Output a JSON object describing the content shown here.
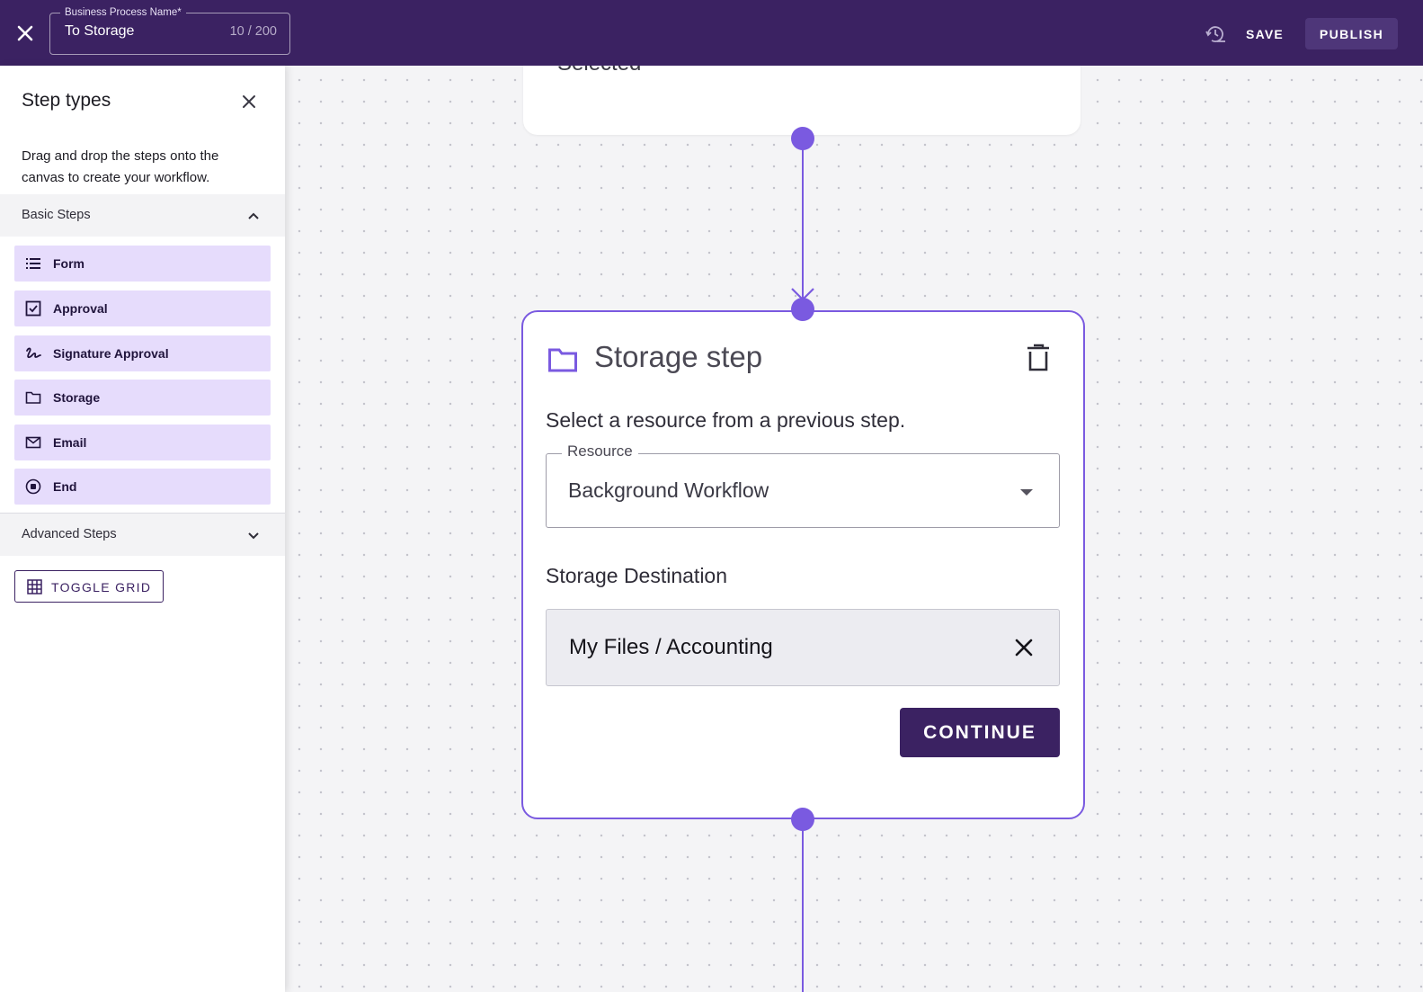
{
  "topbar": {
    "name_label": "Business Process Name*",
    "name_value": "To Storage",
    "name_counter": "10 / 200",
    "save_label": "SAVE",
    "publish_label": "PUBLISH"
  },
  "sidebar": {
    "title": "Step types",
    "description": "Drag and drop the steps onto the canvas to create your workflow.",
    "basic_section": "Basic Steps",
    "advanced_section": "Advanced Steps",
    "steps": [
      {
        "label": "Form",
        "icon": "list-icon"
      },
      {
        "label": "Approval",
        "icon": "checkbox-icon"
      },
      {
        "label": "Signature Approval",
        "icon": "signature-icon"
      },
      {
        "label": "Storage",
        "icon": "folder-icon"
      },
      {
        "label": "Email",
        "icon": "envelope-icon"
      },
      {
        "label": "End",
        "icon": "stop-circle-icon"
      }
    ],
    "toggle_grid_label": "TOGGLE GRID"
  },
  "canvas": {
    "previous_card_text": "Selected",
    "storage_step": {
      "title": "Storage step",
      "hint": "Select a resource from a previous step.",
      "resource_label": "Resource",
      "resource_value": "Background Workflow",
      "destination_label": "Storage Destination",
      "destination_value": "My Files / Accounting",
      "continue_label": "CONTINUE"
    }
  },
  "colors": {
    "brand": "#3b2262",
    "accent": "#7a5ae0",
    "step_item_bg": "#e6dcfc"
  }
}
